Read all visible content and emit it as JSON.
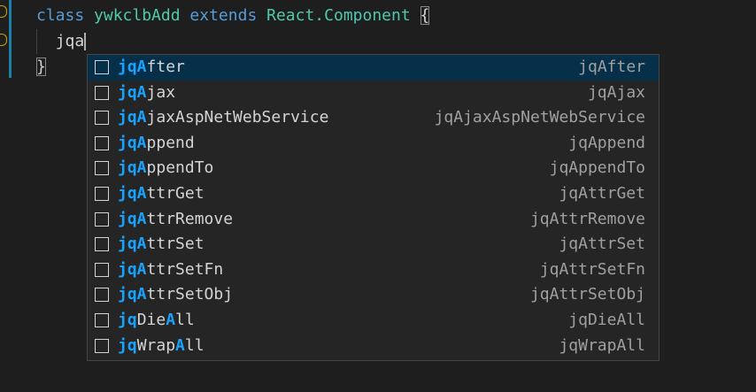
{
  "editor": {
    "line1": {
      "keyword_class": "class",
      "class_name": "ywkclbAdd",
      "keyword_extends": "extends",
      "base_class": "React.Component",
      "open_brace": "{"
    },
    "line2": {
      "typed_text": "jqa"
    },
    "line3": {
      "close_brace": "}"
    }
  },
  "suggestions": {
    "selected_index": 0,
    "items": [
      {
        "match": "jqA",
        "pre": "",
        "rest": "fter",
        "detail": "jqAfter"
      },
      {
        "match": "jqA",
        "pre": "",
        "rest": "jax",
        "detail": "jqAjax"
      },
      {
        "match": "jqA",
        "pre": "",
        "rest": "jaxAspNetWebService",
        "detail": "jqAjaxAspNetWebService"
      },
      {
        "match": "jqA",
        "pre": "",
        "rest": "ppend",
        "detail": "jqAppend"
      },
      {
        "match": "jqA",
        "pre": "",
        "rest": "ppendTo",
        "detail": "jqAppendTo"
      },
      {
        "match": "jqA",
        "pre": "",
        "rest": "ttrGet",
        "detail": "jqAttrGet"
      },
      {
        "match": "jqA",
        "pre": "",
        "rest": "ttrRemove",
        "detail": "jqAttrRemove"
      },
      {
        "match": "jqA",
        "pre": "",
        "rest": "ttrSet",
        "detail": "jqAttrSet"
      },
      {
        "match": "jqA",
        "pre": "",
        "rest": "ttrSetFn",
        "detail": "jqAttrSetFn"
      },
      {
        "match": "jqA",
        "pre": "",
        "rest": "ttrSetObj",
        "detail": "jqAttrSetObj"
      },
      {
        "split": true,
        "p1": "jq",
        "p2": "Die",
        "p3": "A",
        "p4": "ll",
        "detail": "jqDieAll"
      },
      {
        "split": true,
        "p1": "jq",
        "p2": "Wrap",
        "p3": "A",
        "p4": "ll",
        "detail": "jqWrapAll"
      }
    ]
  },
  "colors": {
    "background": "#1e1e1e",
    "keyword": "#569cd6",
    "class_name": "#4ec9b0",
    "match_highlight": "#18a3ff",
    "selected_row": "#062f4a"
  },
  "icons": {
    "suggestion_kind": "snippet-icon"
  }
}
